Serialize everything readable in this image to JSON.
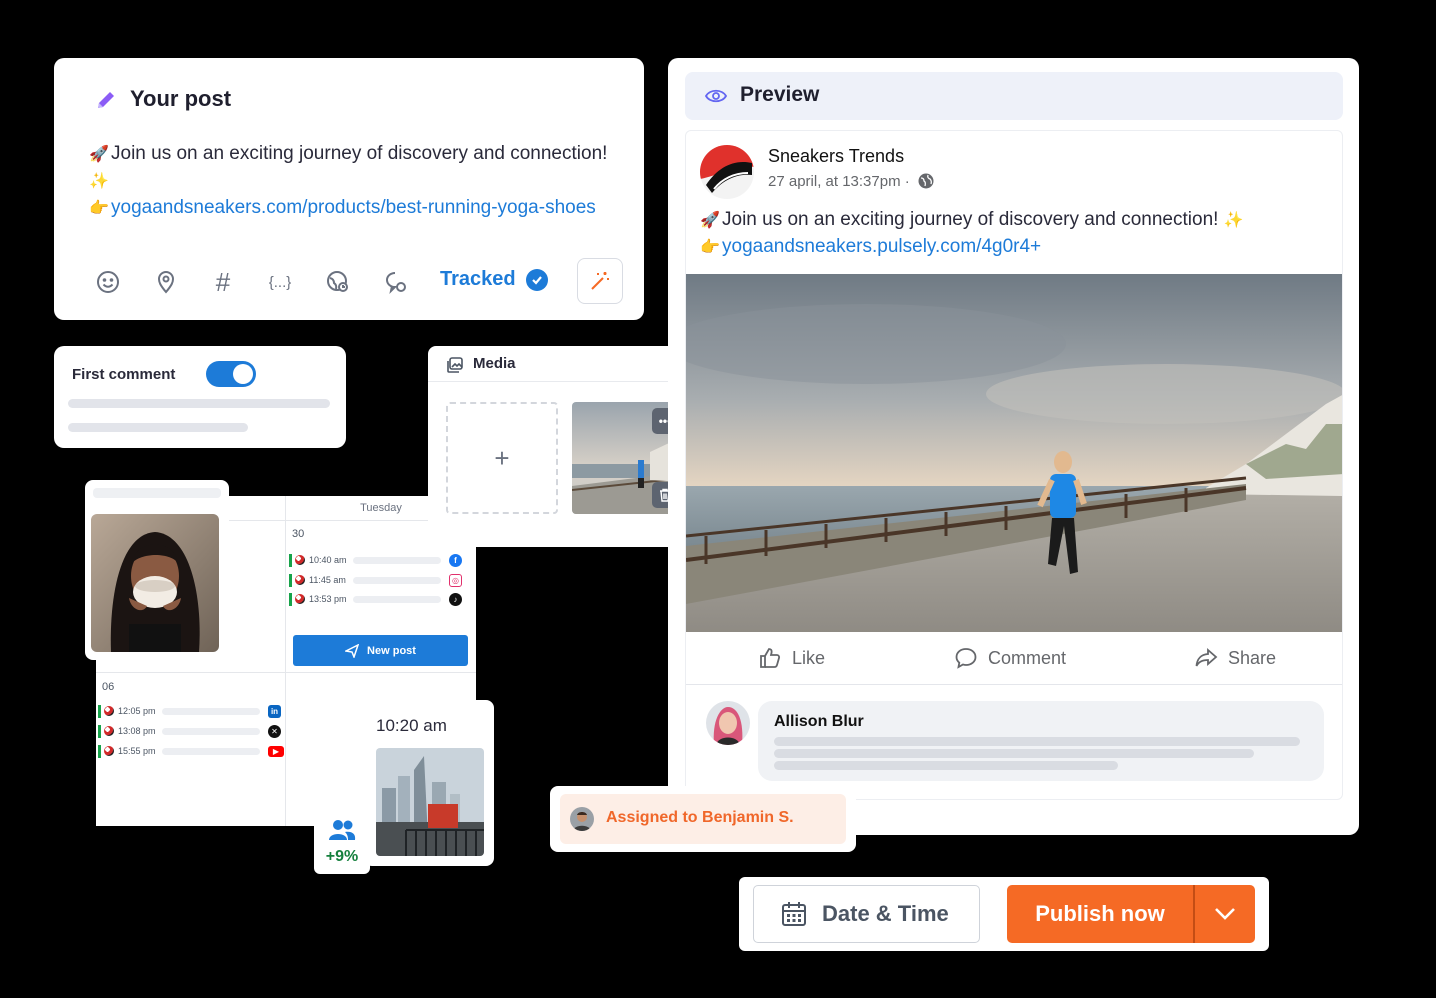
{
  "your_post": {
    "title": "Your post",
    "text_line1": "Join us on an exciting journey of discovery and connection!",
    "link": "yogaandsneakers.com/products/best-running-yoga-shoes",
    "tracked_label": "Tracked",
    "toolbar_icons": [
      "smiley-icon",
      "location-pin-icon",
      "hashtag-icon",
      "variables-icon",
      "globe-icon",
      "chat-icon"
    ]
  },
  "first_comment": {
    "label": "First comment",
    "enabled": true
  },
  "media": {
    "title": "Media",
    "add_label": "+"
  },
  "calendar": {
    "day_name": "Tuesday",
    "day1": {
      "number": "30",
      "posts": [
        {
          "time": "10:40 am",
          "network": "facebook"
        },
        {
          "time": "11:45 am",
          "network": "instagram"
        },
        {
          "time": "13:53 pm",
          "network": "tiktok"
        }
      ]
    },
    "day2": {
      "number": "06",
      "posts": [
        {
          "time": "12:05 pm",
          "network": "linkedin"
        },
        {
          "time": "13:08 pm",
          "network": "x"
        },
        {
          "time": "15:55 pm",
          "network": "youtube"
        }
      ]
    },
    "new_post_label": "New post"
  },
  "scheduled_card": {
    "time": "10:20 am"
  },
  "growth": {
    "value": "+9%"
  },
  "preview": {
    "title": "Preview",
    "page_name": "Sneakers Trends",
    "meta": "27 april, at 13:37pm ·",
    "text": "Join us on an exciting journey of discovery and connection!",
    "link": "yogaandsneakers.pulsely.com/4g0r4+",
    "actions": {
      "like": "Like",
      "comment": "Comment",
      "share": "Share"
    },
    "commenter": "Allison Blur"
  },
  "assigned": {
    "label": "Assigned to Benjamin S."
  },
  "action_bar": {
    "date_time_label": "Date & Time",
    "publish_label": "Publish now"
  },
  "colors": {
    "accent_blue": "#1d7bd8",
    "publish_orange": "#f56a25",
    "growth_green": "#15803d"
  }
}
